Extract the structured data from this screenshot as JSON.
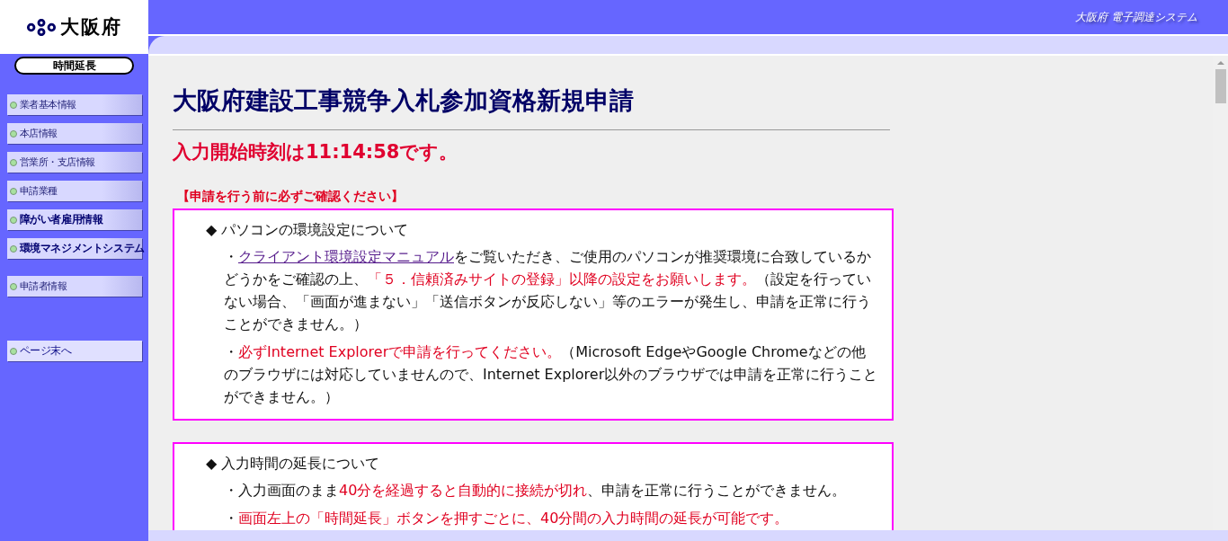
{
  "logo": {
    "text": "大阪府"
  },
  "header": {
    "system_name": "大阪府 電子調達システム"
  },
  "extend_button": {
    "label": "時間延長"
  },
  "sidebar": {
    "groups": [
      [
        {
          "label": "業者基本情報",
          "kind": "nav",
          "emphasis": false
        },
        {
          "label": "本店情報",
          "kind": "nav",
          "emphasis": false
        },
        {
          "label": "営業所・支店情報",
          "kind": "nav",
          "emphasis": false
        },
        {
          "label": "申請業種",
          "kind": "nav",
          "emphasis": false
        },
        {
          "label": "障がい者雇用情報",
          "kind": "nav",
          "emphasis": true
        },
        {
          "label": "環境マネジメントシステム",
          "kind": "nav",
          "emphasis": true
        }
      ],
      [
        {
          "label": "申請者情報",
          "kind": "nav",
          "emphasis": false
        }
      ],
      [
        {
          "label": "ページ末へ",
          "kind": "jump",
          "emphasis": false
        }
      ]
    ]
  },
  "main": {
    "title": "大阪府建設工事競争入札参加資格新規申請",
    "start_time": "入力開始時刻は11:14:58です。",
    "notice_heading": "【申請を行う前に必ずご確認ください】",
    "sections": [
      {
        "heading": "◆ パソコンの環境設定について",
        "paragraphs": [
          [
            {
              "kind": "plain",
              "text": "・"
            },
            {
              "kind": "link",
              "text": "クライアント環境設定マニュアル"
            },
            {
              "kind": "plain",
              "text": "をご覧いただき、ご使用のパソコンが推奨環境に合致しているかどうかをご確認の上、"
            },
            {
              "kind": "red",
              "text": "「５．信頼済みサイトの登録」以降の設定をお願いします。"
            },
            {
              "kind": "plain",
              "text": "（設定を行っていない場合、「画面が進まない」「送信ボタンが反応しない」等のエラーが発生し、申請を正常に行うことができません。）"
            }
          ],
          [
            {
              "kind": "plain",
              "text": "・"
            },
            {
              "kind": "red",
              "text": "必ずInternet Explorerで申請を行ってください。"
            },
            {
              "kind": "plain",
              "text": "（Microsoft EdgeやGoogle Chromeなどの他のブラウザには対応していませんので、Internet Explorer以外のブラウザでは申請を正常に行うことができません。）"
            }
          ]
        ]
      },
      {
        "heading": "◆ 入力時間の延長について",
        "paragraphs": [
          [
            {
              "kind": "plain",
              "text": "・入力画面のまま"
            },
            {
              "kind": "red",
              "text": "40分を経過すると自動的に接続が切れ"
            },
            {
              "kind": "plain",
              "text": "、申請を正常に行うことができません。"
            }
          ],
          [
            {
              "kind": "plain",
              "text": "・"
            },
            {
              "kind": "red",
              "text": "画面左上の「時間延長」ボタンを押すごとに、40分間の入力時間の延長が可能です。"
            }
          ]
        ]
      }
    ]
  }
}
